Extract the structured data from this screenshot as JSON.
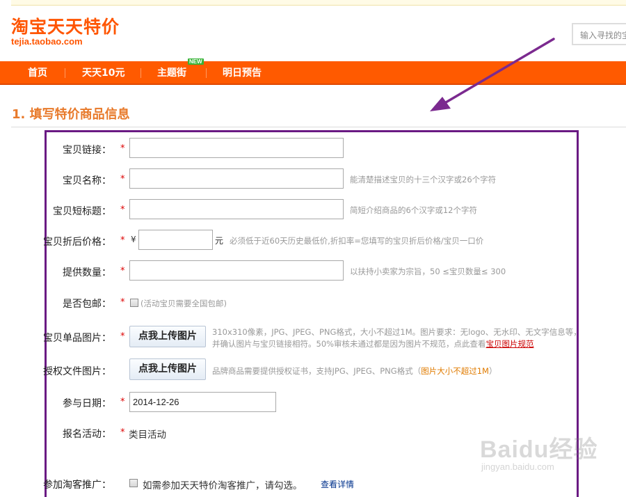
{
  "header": {
    "logo_title": "淘宝天天特价",
    "logo_sub": "tejia.taobao.com",
    "search_placeholder": "输入寻找的宝"
  },
  "nav": {
    "items": [
      {
        "label": "首页"
      },
      {
        "label": "天天10元"
      },
      {
        "label": "主题街"
      },
      {
        "label": "明日预告"
      }
    ],
    "new_badge": "NEW"
  },
  "section": {
    "title": "1. 填写特价商品信息"
  },
  "form": {
    "required_mark": "*",
    "link": {
      "label": "宝贝链接：",
      "value": ""
    },
    "name": {
      "label": "宝贝名称：",
      "value": "",
      "hint": "能清楚描述宝贝的十三个汉字或26个字符"
    },
    "short_title": {
      "label": "宝贝短标题：",
      "value": "",
      "hint": "简短介绍商品的6个汉字或12个字符"
    },
    "price": {
      "label": "宝贝折后价格：",
      "currency": "¥",
      "unit": "元",
      "value": "",
      "hint": "必须低于近60天历史最低价,折扣率=您填写的宝贝折后价格/宝贝一口价"
    },
    "quantity": {
      "label": "提供数量：",
      "value": "",
      "hint": "以扶持小卖家为宗旨，50 ≤宝贝数量≤ 300"
    },
    "free_shipping": {
      "label": "是否包邮：",
      "note": "(活动宝贝需要全国包邮)",
      "checked": false
    },
    "item_image": {
      "label": "宝贝单品图片：",
      "button": "点我上传图片",
      "hint_line1": "310x310像素，JPG、JPEG、PNG格式，大小不超过1M。图片要求：无logo、无水印、无文字信息等，",
      "hint_line2_prefix": "并确认图片与宝贝链接相符。50%审核未通过都是因为图片不规范，点此查看",
      "hint_line2_link": "宝贝图片规范"
    },
    "auth_image": {
      "label": "授权文件图片：",
      "button": "点我上传图片",
      "hint_prefix": "品牌商品需要提供授权证书，支持JPG、JPEG、PNG格式（",
      "hint_highlight": "图片大小不超过1M",
      "hint_suffix": "）"
    },
    "date": {
      "label": "参与日期：",
      "value": "2014-12-26"
    },
    "activity": {
      "label": "报名活动：",
      "value": "类目活动"
    },
    "taoke": {
      "label": "参加淘客推广：",
      "text": "如需参加天天特价淘客推广，请勾选。",
      "link": "查看详情",
      "checked": false
    }
  },
  "colors": {
    "brand_orange": "#ff5a00",
    "section_title": "#e87a2b",
    "highlight_border": "#6a1a83",
    "required_red": "#dd0000"
  },
  "icons": {
    "arrow": "annotation-arrow-icon",
    "checkbox": "checkbox-icon"
  },
  "watermark": {
    "main": "Baidu经验",
    "sub": "jingyan.baidu.com"
  }
}
